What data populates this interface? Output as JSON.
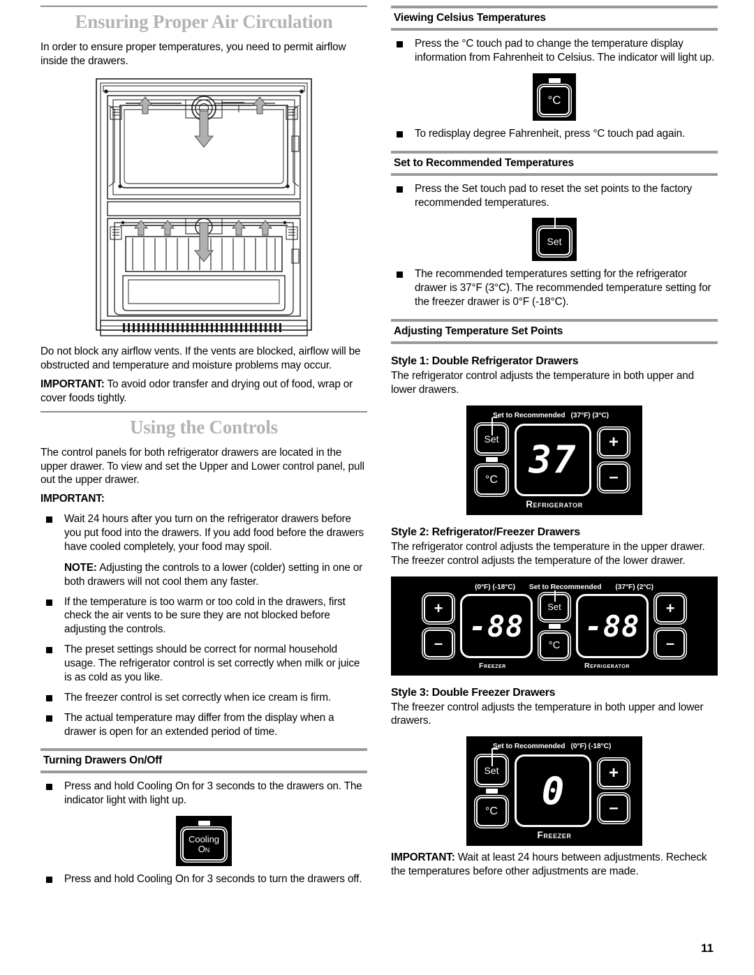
{
  "page": {
    "number": "11"
  },
  "left": {
    "section1": {
      "title": "Ensuring Proper Air Circulation",
      "intro": "In order to ensure proper temperatures, you need to permit airflow inside the drawers.",
      "after_figure": "Do not block any airflow vents. If the vents are blocked, airflow will be obstructed and temperature and moisture problems may occur.",
      "important_label": "IMPORTANT:",
      "important_text": " To avoid odor transfer and drying out of food, wrap or cover foods tightly."
    },
    "section2": {
      "title": "Using the Controls",
      "intro": "The control panels for both refrigerator drawers are located in the upper drawer. To view and set the Upper and Lower control panel, pull out the upper drawer.",
      "important_label": "IMPORTANT:",
      "bullets": [
        {
          "text": "Wait 24 hours after you turn on the refrigerator drawers before you put food into the drawers. If you add food before the drawers have cooled completely, your food may spoil.",
          "note_label": "NOTE:",
          "note_text": " Adjusting the controls to a lower (colder) setting in one or both drawers will not cool them any faster."
        },
        {
          "text": "If the temperature is too warm or too cold in the drawers, first check the air vents to be sure they are not blocked before adjusting the controls."
        },
        {
          "text": "The preset settings should be correct for normal household usage. The refrigerator control is set correctly when milk or juice is as cold as you like."
        },
        {
          "text": "The freezer control is set correctly when ice cream is firm."
        },
        {
          "text": "The actual temperature may differ from the display when a drawer is open for an extended period of time."
        }
      ]
    },
    "section3": {
      "title": "Turning Drawers On/Off",
      "bullet1": "Press and hold Cooling On for 3 seconds to the drawers on. The indicator light with light up.",
      "cooling_button": {
        "line1": "Cooling",
        "line2": "On"
      },
      "bullet2": "Press and hold Cooling On for 3 seconds to turn the drawers off."
    }
  },
  "right": {
    "celsius": {
      "title": "Viewing Celsius Temperatures",
      "bullet1": "Press the °C touch pad to change the temperature display information from Fahrenheit to Celsius. The indicator will light up.",
      "pad_label": "°C",
      "bullet2": "To redisplay degree Fahrenheit, press °C touch pad again."
    },
    "recommended": {
      "title": "Set to Recommended Temperatures",
      "bullet1": "Press the Set touch pad to reset the set points to the factory recommended temperatures.",
      "pad_label": "Set",
      "bullet2": "The recommended temperatures setting for the refrigerator drawer is 37°F (3°C). The recommended temperature setting for the freezer drawer is 0°F (-18°C)."
    },
    "adjusting": {
      "title": "Adjusting Temperature Set Points",
      "style1": {
        "heading": "Style 1: Double Refrigerator Drawers",
        "text": "The refrigerator control adjusts the temperature in both upper and lower drawers.",
        "panel": {
          "label_set": "Set to Recommended",
          "label_temp": "(37°F) (3°C)",
          "key_set": "Set",
          "key_celsius": "°C",
          "key_plus": "+",
          "key_minus": "–",
          "display": "37",
          "caption": "Refrigerator"
        }
      },
      "style2": {
        "heading": "Style 2: Refrigerator/Freezer Drawers",
        "text": "The refrigerator control adjusts the temperature in the upper drawer. The freezer control adjusts the temperature of the lower drawer.",
        "panel": {
          "label_freezer_temp": "(0°F) (-18°C)",
          "label_set": "Set to Recommended",
          "label_fridge_temp": "(37°F) (2°C)",
          "key_plus": "+",
          "key_minus": "–",
          "key_set": "Set",
          "key_celsius": "°C",
          "display_freezer": "-88",
          "display_fridge": "-88",
          "caption_freezer": "Freezer",
          "caption_fridge": "Refrigerator"
        }
      },
      "style3": {
        "heading": "Style 3: Double Freezer Drawers",
        "text": "The freezer control adjusts the temperature in both upper and lower drawers.",
        "panel": {
          "label_set": "Set to Recommended",
          "label_temp": "(0°F) (-18°C)",
          "key_set": "Set",
          "key_celsius": "°C",
          "key_plus": "+",
          "key_minus": "–",
          "display": "0",
          "caption": "Freezer"
        }
      },
      "important_label": "IMPORTANT:",
      "important_text": " Wait at least 24 hours between adjustments. Recheck the temperatures before other adjustments are made."
    }
  }
}
